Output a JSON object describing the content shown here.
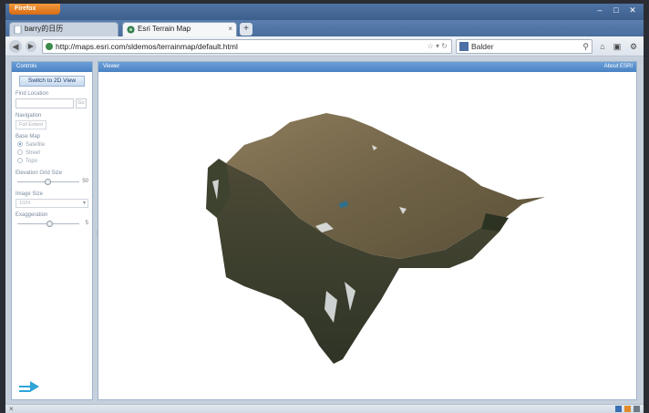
{
  "browser": {
    "menu_button": "Firefox",
    "tabs": [
      {
        "label": "barry的日历"
      },
      {
        "label": "Esri Terrain Map"
      }
    ],
    "new_tab": "+",
    "url": "http://maps.esri.com/sldemos/terrainmap/default.html",
    "search_value": "Balder"
  },
  "controls_panel": {
    "title": "Controls",
    "switch_view_button": "Switch to 2D View",
    "find_location_label": "Find Location",
    "go_button": "Go",
    "navigation_label": "Navigation",
    "full_extent_button": "Full Extent",
    "base_map_label": "Base Map",
    "base_map_options": [
      "Satellite",
      "Street",
      "Topo"
    ],
    "base_map_selected": "Satellite",
    "elevation_grid_label": "Elevation Grid Size",
    "elevation_grid_value": "50",
    "image_size_label": "Image Size",
    "image_size_value": "1024",
    "exaggeration_label": "Exaggeration",
    "exaggeration_value": "5"
  },
  "viewer_panel": {
    "title": "Viewer",
    "about_link": "About ESRI"
  },
  "colors": {
    "panel_header": "#4a82c4",
    "terrain_brown": "#7a6a4e",
    "terrain_green": "#3f4a2e"
  }
}
